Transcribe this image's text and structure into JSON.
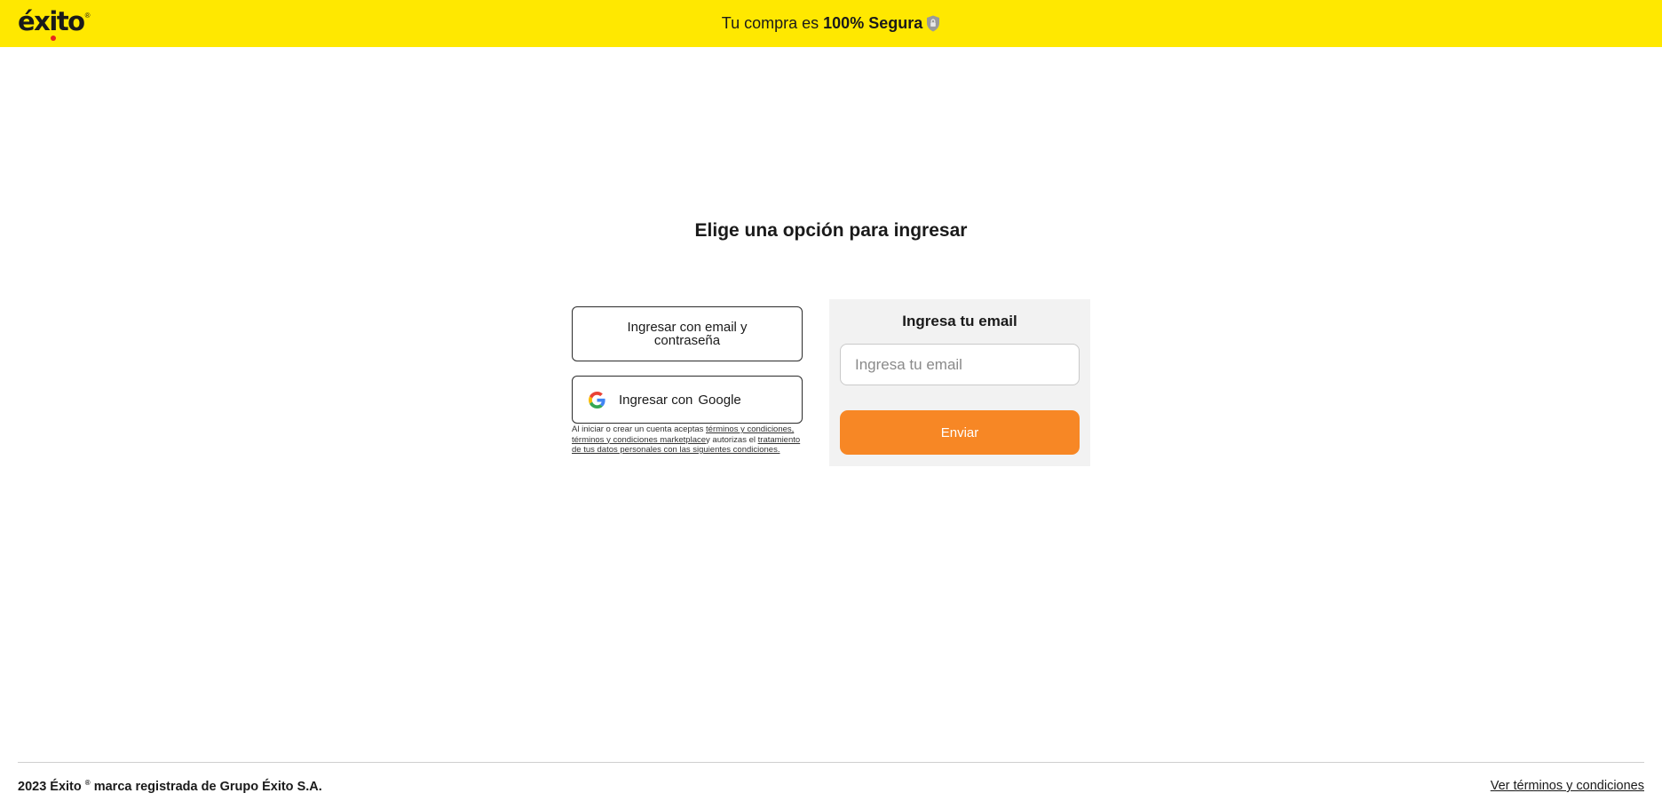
{
  "header": {
    "logo_text": "éxito",
    "logo_reg": "®",
    "secure_prefix": "Tu compra es",
    "secure_strong": "100% Segura",
    "secure_icon": "shield-lock-icon",
    "background_color": "#ffe800"
  },
  "main": {
    "title": "Elige una opción para ingresar",
    "email_password_button": "Ingresar con email y contraseña",
    "google_button_prefix": "Ingresar con",
    "google_button_word": "Google",
    "google_icon": "google-icon",
    "legal": {
      "text1": "Al iniciar o crear un cuenta aceptas",
      "link1": "términos y condiciones,",
      "link2": "términos y condiciones marketplace",
      "text2": "y autorizas el",
      "link3": "tratamiento de tus datos personales con las siguientes condiciones."
    }
  },
  "email_panel": {
    "title": "Ingresa tu email",
    "input_placeholder": "Ingresa tu email",
    "input_value": "",
    "submit_label": "Enviar",
    "accent_color": "#f78725",
    "panel_background": "#f2f2f2"
  },
  "footer": {
    "copyright_prefix": "2023 Éxito",
    "copyright_reg": "®",
    "copyright_suffix": "marca registrada de Grupo Éxito S.A.",
    "terms_link": "Ver términos y condiciones"
  }
}
